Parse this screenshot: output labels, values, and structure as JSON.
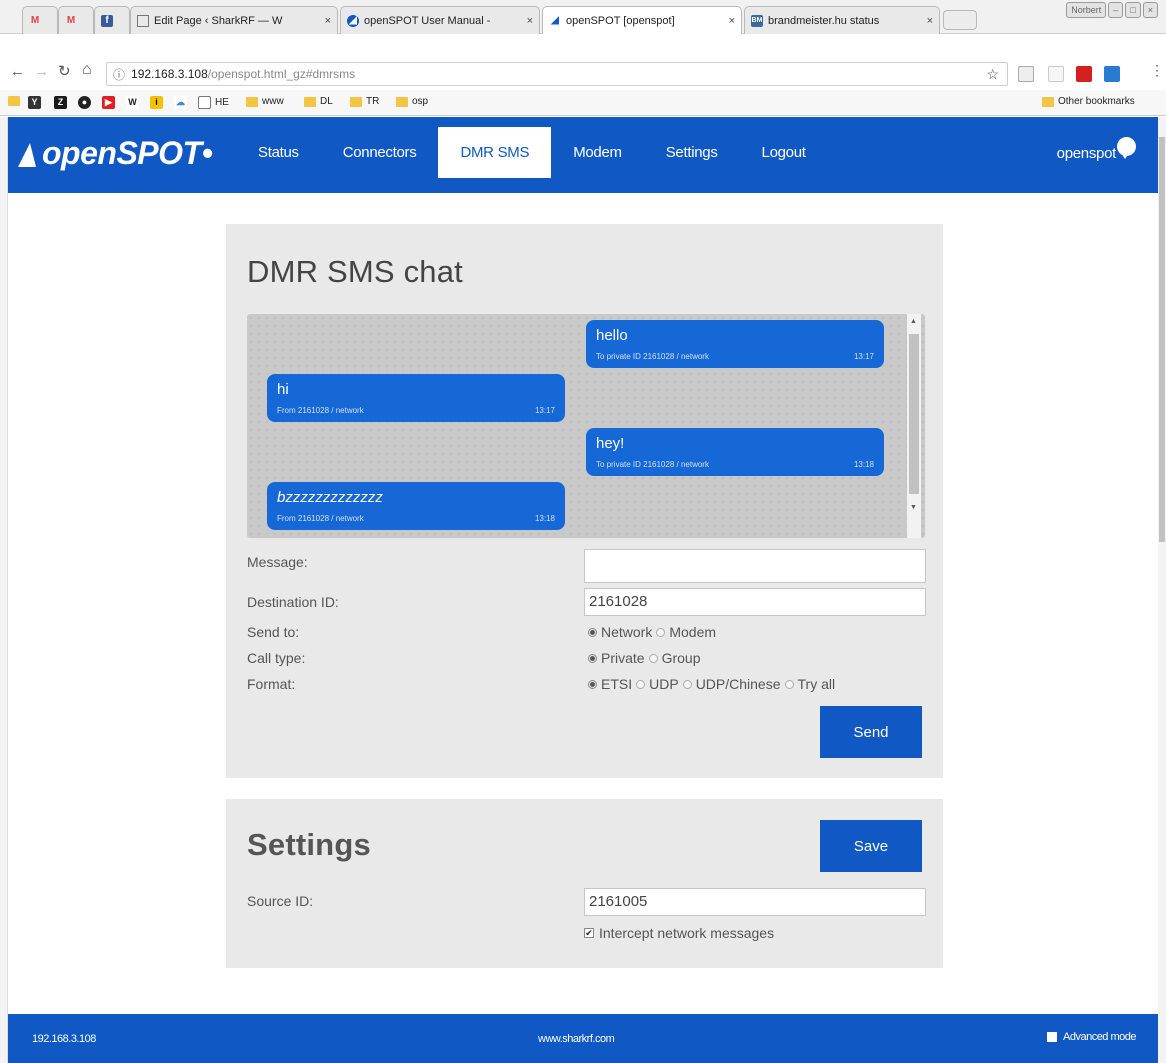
{
  "browser": {
    "tabs": [
      {
        "label": "",
        "icon": "gmail-icon"
      },
      {
        "label": "",
        "icon": "gmail-icon"
      },
      {
        "label": "",
        "icon": "facebook-icon"
      },
      {
        "label": "Edit Page ‹ SharkRF — W",
        "icon": "page-icon"
      },
      {
        "label": "openSPOT User Manual -",
        "icon": "openspot-icon"
      },
      {
        "label": "openSPOT [openspot]",
        "icon": "openspot-icon"
      },
      {
        "label": "brandmeister.hu status",
        "icon": "brandmeister-icon"
      }
    ],
    "tab_close": "×",
    "window_buttons": [
      "Norbert",
      "–",
      "□",
      "×"
    ],
    "url_host": "192.168.3.108",
    "url_path": "/openspot.html_gz#dmrsms",
    "info_glyph": "ⓘ",
    "bookmarks": [
      "HE",
      "www",
      "DL",
      "TR",
      "osp"
    ],
    "other_bookmarks": "Other bookmarks"
  },
  "app": {
    "logo": "openSPOT",
    "nav": [
      "Status",
      "Connectors",
      "DMR SMS",
      "Modem",
      "Settings",
      "Logout"
    ],
    "active_nav": "DMR SMS",
    "hostname": "openspot"
  },
  "chat": {
    "title": "DMR SMS chat",
    "messages": [
      {
        "text": "hello",
        "meta": "To private ID 2161028 / network",
        "time": "13:17",
        "direction": "out"
      },
      {
        "text": "hi",
        "meta": "From 2161028 / network",
        "time": "13:17",
        "direction": "in"
      },
      {
        "text": "hey!",
        "meta": "To private ID 2161028 / network",
        "time": "13:18",
        "direction": "out"
      },
      {
        "text": "bzzzzzzzzzzzzz",
        "meta": "From 2161028 / network",
        "time": "13:18",
        "direction": "in"
      }
    ],
    "form": {
      "message_label": "Message:",
      "message_value": "",
      "destination_label": "Destination ID:",
      "destination_value": "2161028",
      "send_to_label": "Send to:",
      "send_to_options": [
        "Network",
        "Modem"
      ],
      "send_to_selected": "Network",
      "call_type_label": "Call type:",
      "call_type_options": [
        "Private",
        "Group"
      ],
      "call_type_selected": "Private",
      "format_label": "Format:",
      "format_options": [
        "ETSI",
        "UDP",
        "UDP/Chinese",
        "Try all"
      ],
      "format_selected": "ETSI",
      "send_button": "Send"
    }
  },
  "settings": {
    "title": "Settings",
    "save_button": "Save",
    "source_label": "Source ID:",
    "source_value": "2161005",
    "intercept_label": "Intercept network messages",
    "intercept_checked": true
  },
  "footer": {
    "ip": "192.168.3.108",
    "site": "www.sharkrf.com",
    "advanced_mode": "Advanced mode"
  },
  "colors": {
    "brand": "#1058c4",
    "bubble": "#1668d6"
  }
}
